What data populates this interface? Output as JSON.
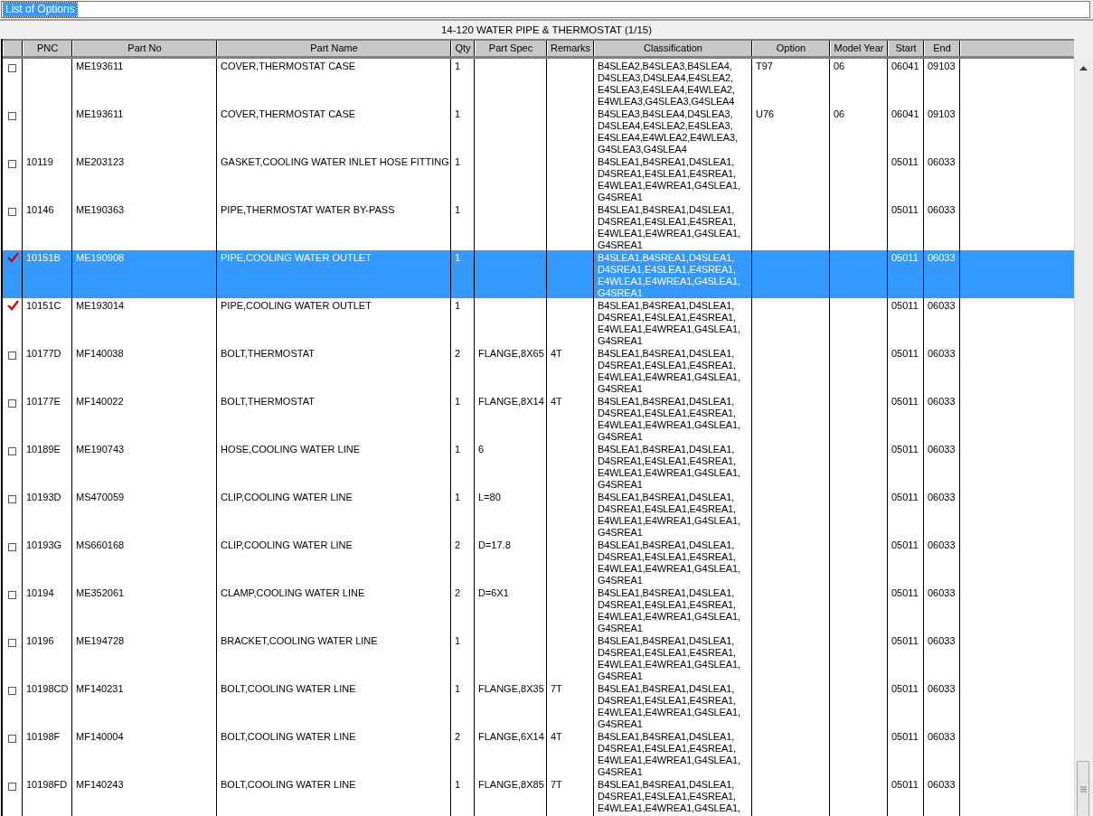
{
  "options_field": {
    "value": "List of Options"
  },
  "title": "14-120 WATER PIPE & THERMOSTAT (1/15)",
  "table": {
    "columns": [
      "PNC",
      "Part No",
      "Part Name",
      "Qty",
      "Part Spec",
      "Remarks",
      "Classification",
      "Option",
      "Model Year",
      "Start",
      "End"
    ],
    "rows": [
      {
        "checked": false,
        "selected": false,
        "part_no": "ME193611",
        "part_name": "COVER,THERMOSTAT CASE",
        "qty": "1",
        "classification": "B4SLEA2,B4SLEA3,B4SLEA4,D4SLEA3,D4SLEA4,E4SLEA2,E4SLEA3,E4SLEA4,E4WLEA2,E4WLEA3,G4SLEA3,G4SLEA4",
        "option": "T97",
        "model_year": "06",
        "start": "06041",
        "end": "09103"
      },
      {
        "checked": false,
        "selected": false,
        "part_no": "ME193611",
        "part_name": "COVER,THERMOSTAT CASE",
        "qty": "1",
        "classification": "B4SLEA3,B4SLEA4,D4SLEA3,D4SLEA4,E4SLEA2,E4SLEA3,E4SLEA4,E4WLEA2,E4WLEA3,G4SLEA3,G4SLEA4",
        "option": "U76",
        "model_year": "06",
        "start": "06041",
        "end": "09103"
      },
      {
        "checked": false,
        "selected": false,
        "pnc": "10119",
        "part_no": "ME203123",
        "part_name": "GASKET,COOLING WATER INLET HOSE FITTING",
        "qty": "1",
        "classification": "B4SLEA1,B4SREA1,D4SLEA1,D4SREA1,E4SLEA1,E4SREA1,E4WLEA1,E4WREA1,G4SLEA1,G4SREA1",
        "start": "05011",
        "end": "06033"
      },
      {
        "checked": false,
        "selected": false,
        "pnc": "10146",
        "part_no": "ME190363",
        "part_name": "PIPE,THERMOSTAT WATER BY-PASS",
        "qty": "1",
        "classification": "B4SLEA1,B4SREA1,D4SLEA1,D4SREA1,E4SLEA1,E4SREA1,E4WLEA1,E4WREA1,G4SLEA1,G4SREA1",
        "start": "05011",
        "end": "06033"
      },
      {
        "checked": true,
        "selected": true,
        "pnc": "10151B",
        "part_no": "ME190908",
        "part_name": "PIPE,COOLING WATER OUTLET",
        "qty": "1",
        "classification": "B4SLEA1,B4SREA1,D4SLEA1,D4SREA1,E4SLEA1,E4SREA1,E4WLEA1,E4WREA1,G4SLEA1,G4SREA1",
        "start": "05011",
        "end": "06033"
      },
      {
        "checked": true,
        "selected": false,
        "pnc": "10151C",
        "part_no": "ME193014",
        "part_name": "PIPE,COOLING WATER OUTLET",
        "qty": "1",
        "classification": "B4SLEA1,B4SREA1,D4SLEA1,D4SREA1,E4SLEA1,E4SREA1,E4WLEA1,E4WREA1,G4SLEA1,G4SREA1",
        "start": "05011",
        "end": "06033"
      },
      {
        "checked": false,
        "selected": false,
        "pnc": "10177D",
        "part_no": "MF140038",
        "part_name": "BOLT,THERMOSTAT",
        "qty": "2",
        "part_spec": "FLANGE,8X65",
        "remarks": "4T",
        "classification": "B4SLEA1,B4SREA1,D4SLEA1,D4SREA1,E4SLEA1,E4SREA1,E4WLEA1,E4WREA1,G4SLEA1,G4SREA1",
        "start": "05011",
        "end": "06033"
      },
      {
        "checked": false,
        "selected": false,
        "pnc": "10177E",
        "part_no": "MF140022",
        "part_name": "BOLT,THERMOSTAT",
        "qty": "1",
        "part_spec": "FLANGE,8X14",
        "remarks": "4T",
        "classification": "B4SLEA1,B4SREA1,D4SLEA1,D4SREA1,E4SLEA1,E4SREA1,E4WLEA1,E4WREA1,G4SLEA1,G4SREA1",
        "start": "05011",
        "end": "06033"
      },
      {
        "checked": false,
        "selected": false,
        "pnc": "10189E",
        "part_no": "ME190743",
        "part_name": "HOSE,COOLING WATER LINE",
        "qty": "1",
        "part_spec": "6",
        "classification": "B4SLEA1,B4SREA1,D4SLEA1,D4SREA1,E4SLEA1,E4SREA1,E4WLEA1,E4WREA1,G4SLEA1,G4SREA1",
        "start": "05011",
        "end": "06033"
      },
      {
        "checked": false,
        "selected": false,
        "pnc": "10193D",
        "part_no": "MS470059",
        "part_name": "CLIP,COOLING WATER LINE",
        "qty": "1",
        "part_spec": "L=80",
        "classification": "B4SLEA1,B4SREA1,D4SLEA1,D4SREA1,E4SLEA1,E4SREA1,E4WLEA1,E4WREA1,G4SLEA1,G4SREA1",
        "start": "05011",
        "end": "06033"
      },
      {
        "checked": false,
        "selected": false,
        "pnc": "10193G",
        "part_no": "MS660168",
        "part_name": "CLIP,COOLING WATER LINE",
        "qty": "2",
        "part_spec": "D=17.8",
        "classification": "B4SLEA1,B4SREA1,D4SLEA1,D4SREA1,E4SLEA1,E4SREA1,E4WLEA1,E4WREA1,G4SLEA1,G4SREA1",
        "start": "05011",
        "end": "06033"
      },
      {
        "checked": false,
        "selected": false,
        "pnc": "10194",
        "part_no": "ME352061",
        "part_name": "CLAMP,COOLING WATER LINE",
        "qty": "2",
        "part_spec": "D=6X1",
        "classification": "B4SLEA1,B4SREA1,D4SLEA1,D4SREA1,E4SLEA1,E4SREA1,E4WLEA1,E4WREA1,G4SLEA1,G4SREA1",
        "start": "05011",
        "end": "06033"
      },
      {
        "checked": false,
        "selected": false,
        "pnc": "10196",
        "part_no": "ME194728",
        "part_name": "BRACKET,COOLING WATER LINE",
        "qty": "1",
        "classification": "B4SLEA1,B4SREA1,D4SLEA1,D4SREA1,E4SLEA1,E4SREA1,E4WLEA1,E4WREA1,G4SLEA1,G4SREA1",
        "start": "05011",
        "end": "06033"
      },
      {
        "checked": false,
        "selected": false,
        "pnc": "10198CD",
        "part_no": "MF140231",
        "part_name": "BOLT,COOLING WATER LINE",
        "qty": "1",
        "part_spec": "FLANGE,8X35",
        "remarks": "7T",
        "classification": "B4SLEA1,B4SREA1,D4SLEA1,D4SREA1,E4SLEA1,E4SREA1,E4WLEA1,E4WREA1,G4SLEA1,G4SREA1",
        "start": "05011",
        "end": "06033"
      },
      {
        "checked": false,
        "selected": false,
        "pnc": "10198F",
        "part_no": "MF140004",
        "part_name": "BOLT,COOLING WATER LINE",
        "qty": "2",
        "part_spec": "FLANGE,6X14",
        "remarks": "4T",
        "classification": "B4SLEA1,B4SREA1,D4SLEA1,D4SREA1,E4SLEA1,E4SREA1,E4WLEA1,E4WREA1,G4SLEA1,G4SREA1",
        "start": "05011",
        "end": "06033"
      },
      {
        "checked": false,
        "selected": false,
        "pnc": "10198FD",
        "part_no": "MF140243",
        "part_name": "BOLT,COOLING WATER LINE",
        "qty": "1",
        "part_spec": "FLANGE,8X85",
        "remarks": "7T",
        "classification": "B4SLEA1,B4SREA1,D4SLEA1,D4SREA1,E4SLEA1,E4SREA1,E4WLEA1,E4WREA1,G4SLEA1,",
        "start": "05011",
        "end": "06033"
      }
    ]
  }
}
